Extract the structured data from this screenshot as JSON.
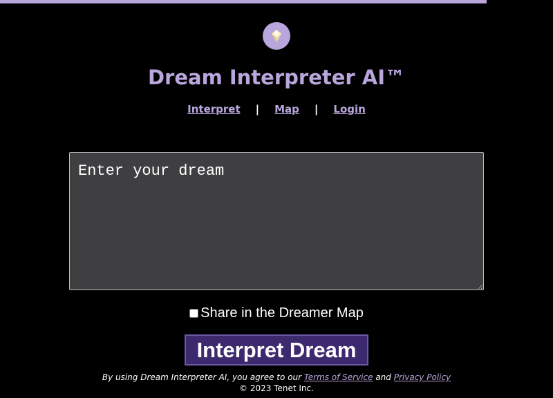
{
  "colors": {
    "background": "#000000",
    "accent": "#b9a6dd",
    "textarea_bg": "#3f3f42",
    "button_bg": "#3d2a6e",
    "button_border": "#6b59a4",
    "text": "#ffffff"
  },
  "progress": {
    "value": 0.88
  },
  "logo": {
    "icon": "gem-icon"
  },
  "header": {
    "title": "Dream Interpreter AI™"
  },
  "nav": {
    "items": [
      {
        "label": "Interpret"
      },
      {
        "label": "Map"
      },
      {
        "label": "Login"
      }
    ],
    "separator": "|"
  },
  "dream_input": {
    "placeholder": "Enter your dream",
    "value": ""
  },
  "share": {
    "label": "Share in the Dreamer Map",
    "checked": false
  },
  "submit": {
    "label": "Interpret Dream"
  },
  "footer": {
    "prefix": "By using Dream Interpreter AI, you agree to our ",
    "terms_label": "Terms of Service",
    "and_text": " and ",
    "privacy_label": "Privacy Policy",
    "copyright": "© 2023 Tenet Inc."
  }
}
